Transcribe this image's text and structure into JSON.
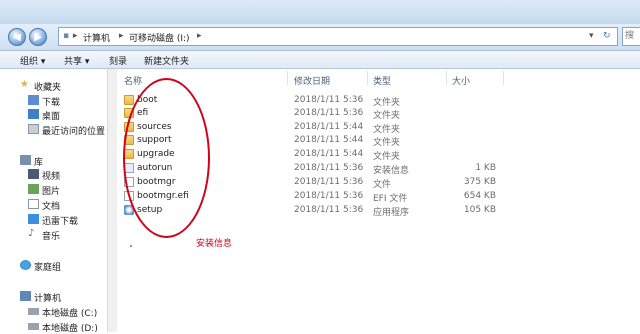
{
  "address": {
    "crumbs": [
      "计算机",
      "可移动磁盘 (I:)"
    ],
    "search_placeholder": "搜"
  },
  "toolbar": {
    "organize": "组织 ▾",
    "share": "共享 ▾",
    "burn": "刻录",
    "new_folder": "新建文件夹"
  },
  "sidebar": {
    "favorites": "收藏夹",
    "downloads": "下载",
    "desktop": "桌面",
    "recent": "最近访问的位置",
    "libraries": "库",
    "videos": "视频",
    "pictures": "图片",
    "documents": "文档",
    "xunlei": "迅雷下载",
    "music": "音乐",
    "homegroup": "家庭组",
    "computer": "计算机",
    "drive_c": "本地磁盘 (C:)",
    "drive_d": "本地磁盘 (D:)"
  },
  "columns": {
    "name": "名称",
    "date": "修改日期",
    "type": "类型",
    "size": "大小"
  },
  "files": [
    {
      "name": "boot",
      "date": "2018/1/11 5:36",
      "type": "文件夹",
      "size": "",
      "icon": "folder-icon"
    },
    {
      "name": "efi",
      "date": "2018/1/11 5:36",
      "type": "文件夹",
      "size": "",
      "icon": "folder-icon"
    },
    {
      "name": "sources",
      "date": "2018/1/11 5:44",
      "type": "文件夹",
      "size": "",
      "icon": "folder-icon"
    },
    {
      "name": "support",
      "date": "2018/1/11 5:44",
      "type": "文件夹",
      "size": "",
      "icon": "folder-icon"
    },
    {
      "name": "upgrade",
      "date": "2018/1/11 5:44",
      "type": "文件夹",
      "size": "",
      "icon": "folder-icon"
    },
    {
      "name": "autorun",
      "date": "2018/1/11 5:36",
      "type": "安装信息",
      "size": "1 KB",
      "icon": "settings-file-icon"
    },
    {
      "name": "bootmgr",
      "date": "2018/1/11 5:36",
      "type": "文件",
      "size": "375 KB",
      "icon": "file-icon"
    },
    {
      "name": "bootmgr.efi",
      "date": "2018/1/11 5:36",
      "type": "EFI 文件",
      "size": "654 KB",
      "icon": "file-icon"
    },
    {
      "name": "setup",
      "date": "2018/1/11 5:36",
      "type": "应用程序",
      "size": "105 KB",
      "icon": "setup-app-icon"
    }
  ],
  "annotation": "安装信息",
  "colors": {
    "annotation": "#d0021b",
    "titlebar": "#dceaf7"
  }
}
